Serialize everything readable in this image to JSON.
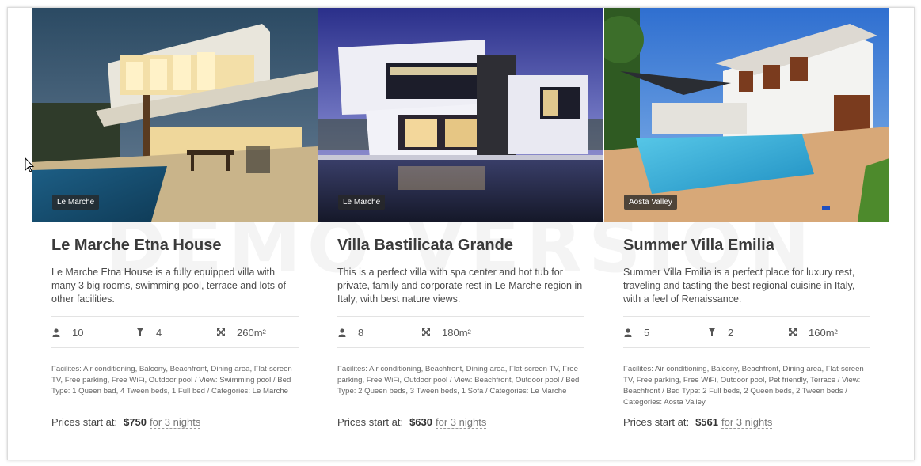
{
  "watermark": "DEMO VERSION",
  "cards": [
    {
      "region": "Le Marche",
      "title": "Le Marche Etna House",
      "description": "Le Marche Etna House is a fully equipped villa with many 3 big rooms, swimming pool, terrace and lots of other facilities.",
      "guests": "10",
      "beds": "4",
      "area": "260m²",
      "facilities": "Facilites: Air conditioning, Balcony, Beachfront, Dining area, Flat-screen TV, Free parking, Free WiFi, Outdoor pool  /  View: Swimming pool  /  Bed Type: 1 Queen bad, 4 Tween beds, 1 Full bed  /  Categories: Le Marche",
      "price_label": "Prices start at:",
      "price": "$750",
      "nights": "for 3 nights"
    },
    {
      "region": "Le Marche",
      "title": "Villa Bastilicata Grande",
      "description": "This is a perfect villa with spa center and hot tub for private, family and corporate rest in Le Marche region in Italy, with best nature views.",
      "guests": "8",
      "area": "180m²",
      "facilities": "Facilites: Air conditioning, Beachfront, Dining area, Flat-screen TV, Free parking, Free WiFi, Outdoor pool  /  View: Beachfront, Outdoor pool  /  Bed Type: 2 Queen beds, 3 Tween beds, 1 Sofa  /  Categories: Le Marche",
      "price_label": "Prices start at:",
      "price": "$630",
      "nights": "for 3 nights"
    },
    {
      "region": "Aosta Valley",
      "title": "Summer Villa Emilia",
      "description": "Summer Villa Emilia is a perfect place for luxury rest, traveling and tasting the best regional cuisine in Italy, with a feel of Renaissance.",
      "guests": "5",
      "beds": "2",
      "area": "160m²",
      "facilities": "Facilites: Air conditioning, Balcony, Beachfront, Dining area, Flat-screen TV, Free parking, Free WiFi, Outdoor pool, Pet friendly, Terrace  /  View: Beachfront  /  Bed Type: 2 Full beds, 2 Queen beds, 2 Tween beds  /  Categories: Aosta Valley",
      "price_label": "Prices start at:",
      "price": "$561",
      "nights": "for 3 nights"
    }
  ]
}
